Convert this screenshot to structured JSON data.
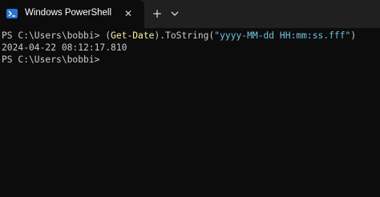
{
  "tab": {
    "title": "Windows PowerShell",
    "icon": "powershell-icon",
    "close_glyph": "✕"
  },
  "toolbar": {
    "new_tab_glyph": "+",
    "dropdown_icon": "chevron-down-icon"
  },
  "terminal": {
    "lines": [
      {
        "prompt": "PS C:\\Users\\bobbi> ",
        "open_paren": "(",
        "cmdlet": "Get-Date",
        "member": ").ToString(",
        "string_arg": "\"yyyy-MM-dd HH:mm:ss.fff\"",
        "close_paren": ")"
      },
      {
        "output": "2024-04-22 08:12:17.810"
      },
      {
        "prompt": "PS C:\\Users\\bobbi>"
      }
    ]
  },
  "colors": {
    "background": "#0c0c0c",
    "titlebar": "#202020",
    "text": "#cccccc",
    "cmdlet": "#f9f1a5",
    "string": "#6fc3df"
  }
}
